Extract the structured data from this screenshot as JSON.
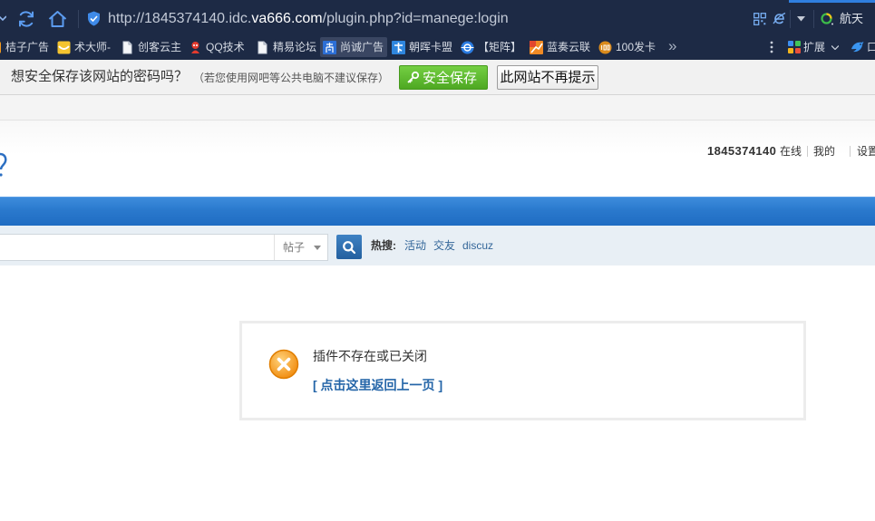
{
  "browser": {
    "url": {
      "prefix": "http://1845374140.idc.",
      "domain": "va666.com",
      "path": "/plugin.php?id=manege:login"
    },
    "search_engine": {
      "label": "航天",
      "icon": "search-engine-icon"
    },
    "bookmarks": [
      {
        "label": "桔子广告",
        "icon": "orange-site-icon"
      },
      {
        "label": "术大师-",
        "icon": "yellow-face-icon"
      },
      {
        "label": "创客云主",
        "icon": "page-icon"
      },
      {
        "label": "QQ技术",
        "icon": "red-mascot-icon"
      },
      {
        "label": "精易论坛",
        "icon": "page-icon"
      },
      {
        "label": "尚诚广告",
        "icon": "blue-site-icon"
      },
      {
        "label": "朝晖卡盟",
        "icon": "card-site-icon"
      },
      {
        "label": "【矩阵】",
        "icon": "globe-icon"
      },
      {
        "label": "蓝奏云联",
        "icon": "chart-site-icon"
      },
      {
        "label": "100发卡",
        "icon": "100-badge-icon"
      }
    ],
    "bookmarks_more": "»",
    "extensions": {
      "label": "扩展",
      "icon": "extensions-grid-icon"
    },
    "extra_item": {
      "label": "口",
      "icon": "bird-icon"
    }
  },
  "password_prompt": {
    "question": "想安全保存该网站的密码吗？",
    "note": "（若您使用网吧等公共电脑不建议保存）",
    "save_button": "安全保存",
    "never_button": "此网站不再提示"
  },
  "site": {
    "user": {
      "name": "1845374140",
      "status": "在线",
      "my": "我的",
      "settings": "设置"
    },
    "search": {
      "query": "",
      "type": "帖子",
      "hot_label": "热搜:",
      "hot_terms": [
        "活动",
        "交友",
        "discuz"
      ]
    },
    "message": {
      "text": "插件不存在或已关闭",
      "back_link": "[ 点击这里返回上一页 ]"
    }
  },
  "colors": {
    "chrome_background": "#1d2a45",
    "save_button_green": "#52ad25",
    "nav_blue": "#2b7acd",
    "search_bar_background": "#e8eff5",
    "link_blue": "#336699",
    "alert_orange": "#f39a1c"
  }
}
